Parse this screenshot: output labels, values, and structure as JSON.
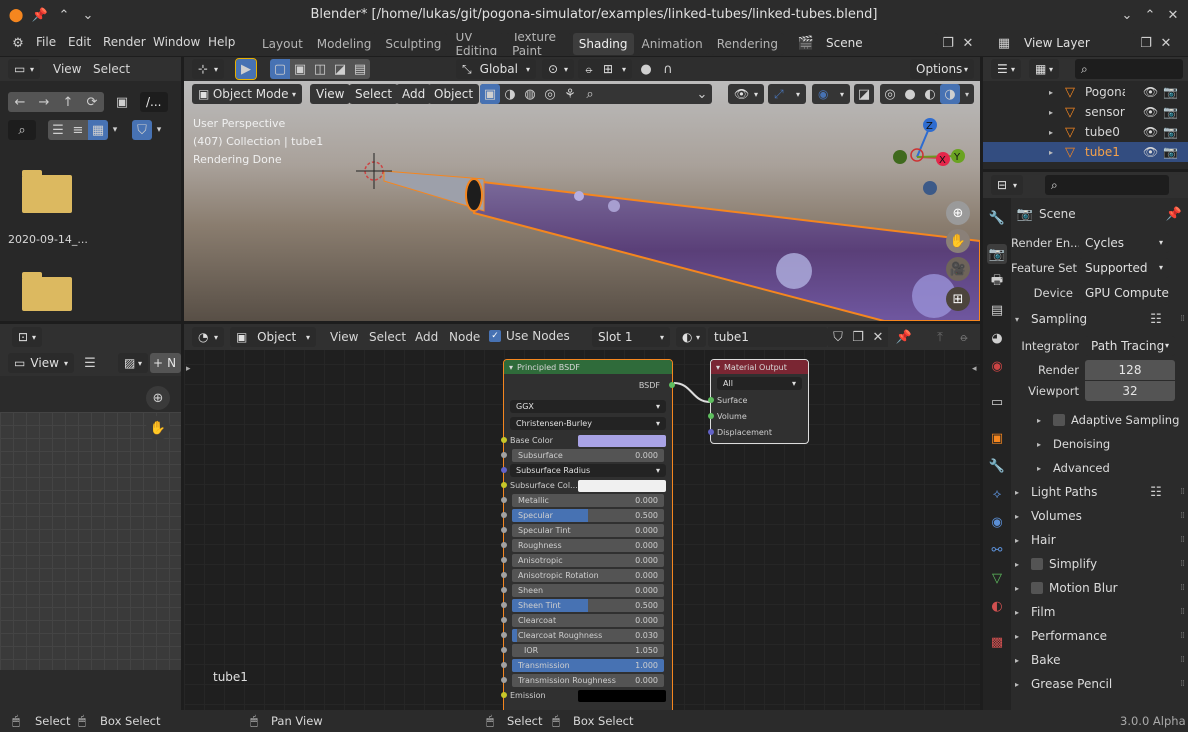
{
  "window": {
    "title": "Blender* [/home/lukas/git/pogona-simulator/examples/linked-tubes/linked-tubes.blend]"
  },
  "menu": [
    "File",
    "Edit",
    "Render",
    "Window",
    "Help"
  ],
  "workspaces": [
    "Layout",
    "Modeling",
    "Sculpting",
    "UV Editing",
    "Texture Paint",
    "Shading",
    "Animation",
    "Rendering"
  ],
  "active_workspace": "Shading",
  "scene_name": "Scene",
  "view_layer": "View Layer",
  "filebrowser": {
    "view": "View",
    "select": "Select",
    "path_btn": "/...",
    "items": [
      {
        "name": "2020-09-14_..."
      },
      {
        "name": ""
      }
    ]
  },
  "image_editor": {
    "view": "View",
    "new_label": "N",
    "bottom_label": "tube1"
  },
  "viewport": {
    "transform": "Global",
    "options": "Options",
    "mode": "Object Mode",
    "menus": [
      "View",
      "Select",
      "Add",
      "Object"
    ],
    "overlay_lines": [
      "User Perspective",
      "(407) Collection | tube1",
      "Rendering Done"
    ],
    "gizmo": {
      "x": "X",
      "y": "Y",
      "z": "Z"
    }
  },
  "node_editor": {
    "type": "Object",
    "menus": [
      "View",
      "Select",
      "Add",
      "Node"
    ],
    "use_nodes": "Use Nodes",
    "slot": "Slot 1",
    "material": "tube1"
  },
  "principled": {
    "title": "Principled BSDF",
    "output": "BSDF",
    "distribution": "GGX",
    "subsurface_method": "Christensen-Burley",
    "base_color_label": "Base Color",
    "base_color": "#a9a3e6",
    "rows": [
      {
        "label": "Subsurface",
        "value": "0.000",
        "fill": 0
      },
      {
        "label": "Subsurface Radius",
        "value": "",
        "fill": 0,
        "dropdown": true
      },
      {
        "label": "Subsurface Col...",
        "value": "",
        "color": "#f0f0f0"
      },
      {
        "label": "Metallic",
        "value": "0.000",
        "fill": 0
      },
      {
        "label": "Specular",
        "value": "0.500",
        "fill": 0.5
      },
      {
        "label": "Specular Tint",
        "value": "0.000",
        "fill": 0
      },
      {
        "label": "Roughness",
        "value": "0.000",
        "fill": 0
      },
      {
        "label": "Anisotropic",
        "value": "0.000",
        "fill": 0
      },
      {
        "label": "Anisotropic Rotation",
        "value": "0.000",
        "fill": 0
      },
      {
        "label": "Sheen",
        "value": "0.000",
        "fill": 0
      },
      {
        "label": "Sheen Tint",
        "value": "0.500",
        "fill": 0.5
      },
      {
        "label": "Clearcoat",
        "value": "0.000",
        "fill": 0
      },
      {
        "label": "Clearcoat Roughness",
        "value": "0.030",
        "fill": 0.03
      },
      {
        "label": "IOR",
        "value": "1.050",
        "fill": 0
      },
      {
        "label": "Transmission",
        "value": "1.000",
        "fill": 1
      },
      {
        "label": "Transmission Roughness",
        "value": "0.000",
        "fill": 0
      },
      {
        "label": "Emission",
        "value": "",
        "color": "#000000"
      }
    ]
  },
  "material_output": {
    "title": "Material Output",
    "target": "All",
    "inputs": [
      "Surface",
      "Volume",
      "Displacement"
    ]
  },
  "outliner": {
    "items": [
      {
        "name": "Pogona"
      },
      {
        "name": "sensor"
      },
      {
        "name": "tube0"
      },
      {
        "name": "tube1"
      }
    ]
  },
  "properties": {
    "scene": "Scene",
    "render_engine_label": "Render En...",
    "render_engine": "Cycles",
    "feature_set_label": "Feature Set",
    "feature_set": "Supported",
    "device_label": "Device",
    "device": "GPU Compute",
    "sampling": "Sampling",
    "integrator_label": "Integrator",
    "integrator": "Path Tracing",
    "render_label": "Render",
    "render_samples": "128",
    "viewport_label": "Viewport",
    "viewport_samples": "32",
    "sub_panels": [
      "Adaptive Sampling",
      "Denoising",
      "Advanced"
    ],
    "panels": [
      "Light Paths",
      "Volumes",
      "Hair",
      "Simplify",
      "Motion Blur",
      "Film",
      "Performance",
      "Bake",
      "Grease Pencil"
    ]
  },
  "statusbar": {
    "left": [
      "Select",
      "Box Select",
      "Pan View"
    ],
    "mid": [
      "Select",
      "Box Select"
    ],
    "version": "3.0.0 Alpha"
  },
  "colors": {
    "accent": "#4772b3",
    "selection_orange": "#f5861f",
    "node_header_green": "#2f6b3a",
    "node_header_red": "#7a2633"
  }
}
